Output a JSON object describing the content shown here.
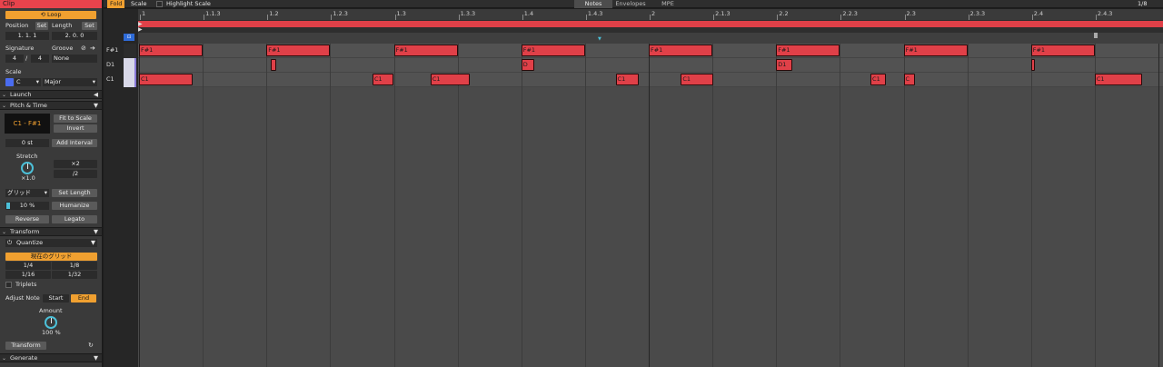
{
  "clip": {
    "title": "Clip",
    "loop_label": "Loop"
  },
  "position": {
    "position_label": "Position",
    "set_label": "Set",
    "length_label": "Length",
    "position_value": "1.  1.  1",
    "length_value": "2.  0.  0"
  },
  "signature": {
    "signature_label": "Signature",
    "numerator": "4",
    "slash": "/",
    "denominator": "4",
    "groove_label": "Groove",
    "groove_value": "None"
  },
  "scale": {
    "label": "Scale",
    "root": "C",
    "mode": "Major"
  },
  "launch": {
    "label": "Launch"
  },
  "pitch_time": {
    "label": "Pitch & Time",
    "range": "C1 - F#1",
    "fit_to_scale": "Fit to Scale",
    "invert": "Invert",
    "semitones": "0 st",
    "add_interval": "Add Interval",
    "stretch_label": "Stretch",
    "stretch_value": "×1.0",
    "x2": "×2",
    "div2": "/2",
    "grid_select": "グリッド",
    "set_length": "Set Length",
    "humanize_value": "10 %",
    "humanize": "Humanize",
    "reverse": "Reverse",
    "legato": "Legato"
  },
  "transform": {
    "label": "Transform",
    "mode": "Quantize",
    "current_grid": "現在のグリッド",
    "q_1_4": "1/4",
    "q_1_8": "1/8",
    "q_1_16": "1/16",
    "q_1_32": "1/32",
    "triplets": "Triplets",
    "adjust_note": "Adjust Note",
    "start": "Start",
    "end": "End",
    "amount_label": "Amount",
    "amount_value": "100 %",
    "transform_button": "Transform"
  },
  "generate": {
    "label": "Generate"
  },
  "toolbar": {
    "fold": "Fold",
    "scale": "Scale",
    "highlight_scale": "Highlight Scale",
    "tabs": [
      "Notes",
      "Envelopes",
      "MPE"
    ],
    "grid_value": "1/8"
  },
  "keys": [
    "F#1",
    "D1",
    "C1"
  ],
  "ruler": [
    "1",
    "1.1.3",
    "1.2",
    "1.2.3",
    "1.3",
    "1.3.3",
    "1.4",
    "1.4.3",
    "2",
    "2.1.3",
    "2.2",
    "2.2.3",
    "2.3",
    "2.3.3",
    "2.4",
    "2.4.3"
  ],
  "notes": [
    {
      "pitch": "F#1",
      "label": "F#1",
      "start": 0.0,
      "dur": 0.125
    },
    {
      "pitch": "F#1",
      "label": "F#1",
      "start": 0.25,
      "dur": 0.125
    },
    {
      "pitch": "F#1",
      "label": "F#1",
      "start": 0.5,
      "dur": 0.125
    },
    {
      "pitch": "F#1",
      "label": "F#1",
      "start": 0.75,
      "dur": 0.125
    },
    {
      "pitch": "F#1",
      "label": "F#1",
      "start": 1.0,
      "dur": 0.125
    },
    {
      "pitch": "F#1",
      "label": "F#1",
      "start": 1.25,
      "dur": 0.125
    },
    {
      "pitch": "F#1",
      "label": "F#1",
      "start": 1.5,
      "dur": 0.125
    },
    {
      "pitch": "F#1",
      "label": "F#1",
      "start": 1.75,
      "dur": 0.125
    },
    {
      "pitch": "D1",
      "label": "",
      "start": 0.258,
      "dur": 0.012
    },
    {
      "pitch": "D1",
      "label": "D",
      "start": 0.75,
      "dur": 0.025
    },
    {
      "pitch": "D1",
      "label": "D1",
      "start": 1.25,
      "dur": 0.032
    },
    {
      "pitch": "D1",
      "label": "",
      "start": 1.75,
      "dur": 0.008
    },
    {
      "pitch": "C1",
      "label": "C1",
      "start": 0.0,
      "dur": 0.105
    },
    {
      "pitch": "C1",
      "label": "C1",
      "start": 0.458,
      "dur": 0.042
    },
    {
      "pitch": "C1",
      "label": "C1",
      "start": 0.572,
      "dur": 0.076
    },
    {
      "pitch": "C1",
      "label": "C1",
      "start": 0.935,
      "dur": 0.046
    },
    {
      "pitch": "C1",
      "label": "C1",
      "start": 1.063,
      "dur": 0.063
    },
    {
      "pitch": "C1",
      "label": "C1",
      "start": 1.435,
      "dur": 0.03
    },
    {
      "pitch": "C1",
      "label": "C",
      "start": 1.5,
      "dur": 0.022
    },
    {
      "pitch": "C1",
      "label": "C1",
      "start": 1.875,
      "dur": 0.093
    }
  ],
  "colors": {
    "accent": "#f0a030",
    "note": "#e04048",
    "clip_title": "#e8434c",
    "knob": "#4cc0d8"
  }
}
